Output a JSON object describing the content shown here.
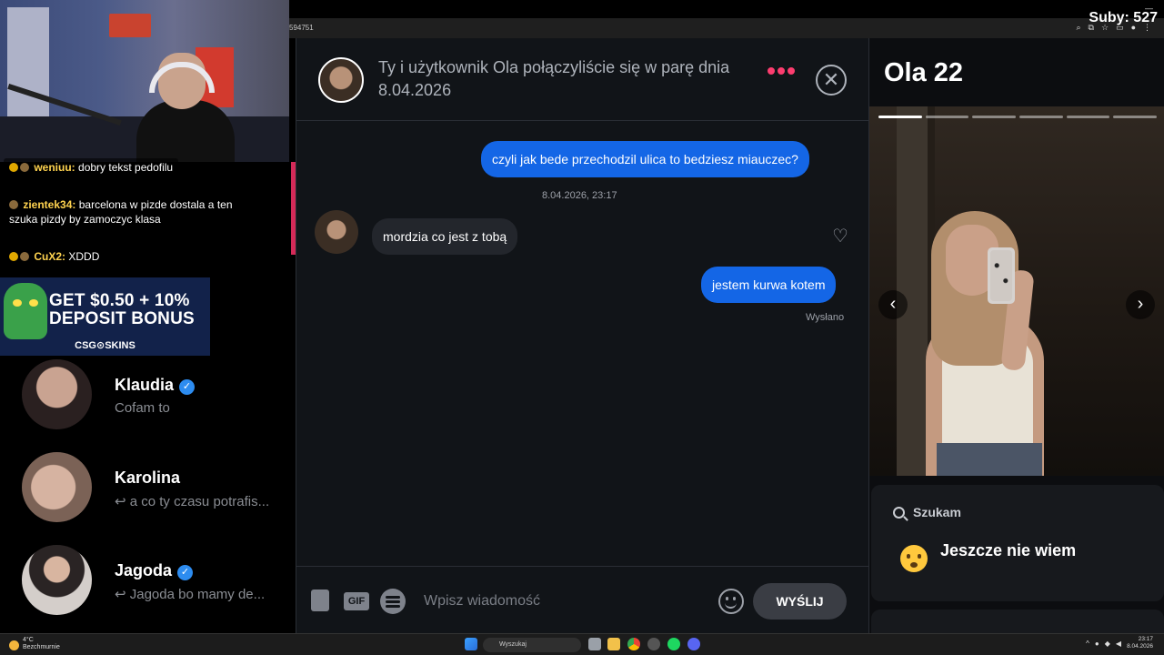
{
  "browser": {
    "url_fragment": "594751",
    "stream_subs": "Suby: 527",
    "icons": [
      "zoom-icon",
      "extensions-icon",
      "star-icon",
      "tab-icon",
      "profile-icon",
      "menu-icon"
    ]
  },
  "stream_chat": [
    {
      "user": "weniuu:",
      "text": "dobry tekst pedofilu"
    },
    {
      "user": "zientek34:",
      "text": "barcelona w pizde dostala a ten szuka pizdy by zamoczyc klasa"
    },
    {
      "user": "CuX2:",
      "text": "XDDD"
    }
  ],
  "ad": {
    "line1": "GET $0.50 + 10%",
    "line2": "DEPOSIT BONUS",
    "brand": "CSG⊙SKINS"
  },
  "matches": [
    {
      "name": "Klaudia",
      "verified": true,
      "preview": "Cofam to"
    },
    {
      "name": "Karolina",
      "verified": false,
      "preview": "↩ a co ty czasu potrafis..."
    },
    {
      "name": "Jagoda",
      "verified": true,
      "preview": "↩ Jagoda bo mamy de..."
    }
  ],
  "chat": {
    "header_title": "Ty i użytkownik Ola połączyliście się w parę dnia 8.04.2026",
    "messages": [
      {
        "from": "me",
        "text": "czyli jak bede przechodzil ulica to bedziesz miauczec?"
      },
      {
        "type": "timestamp",
        "text": "8.04.2026, 23:17"
      },
      {
        "from": "them",
        "text": "mordzia co jest z tobą"
      },
      {
        "from": "me",
        "text": "jestem kurwa kotem"
      }
    ],
    "status": "Wysłano",
    "composer_placeholder": "Wpisz wiadomość",
    "gif_label": "GIF",
    "send_label": "WYŚLIJ"
  },
  "profile": {
    "name_age": "Ola 22",
    "photo_count": 6,
    "photo_index": 1,
    "looking_for_label": "Szukam",
    "looking_for_value": "Jeszcze nie wiem"
  },
  "taskbar": {
    "weather_temp": "4°C",
    "weather_desc": "Bezchmurnie",
    "search_placeholder": "Wyszukaj",
    "time": "23:17",
    "date": "8.04.2026"
  },
  "colors": {
    "accent_blue": "#1466e6",
    "accent_pink": "#fd3d6f",
    "panel_bg": "#111418"
  }
}
